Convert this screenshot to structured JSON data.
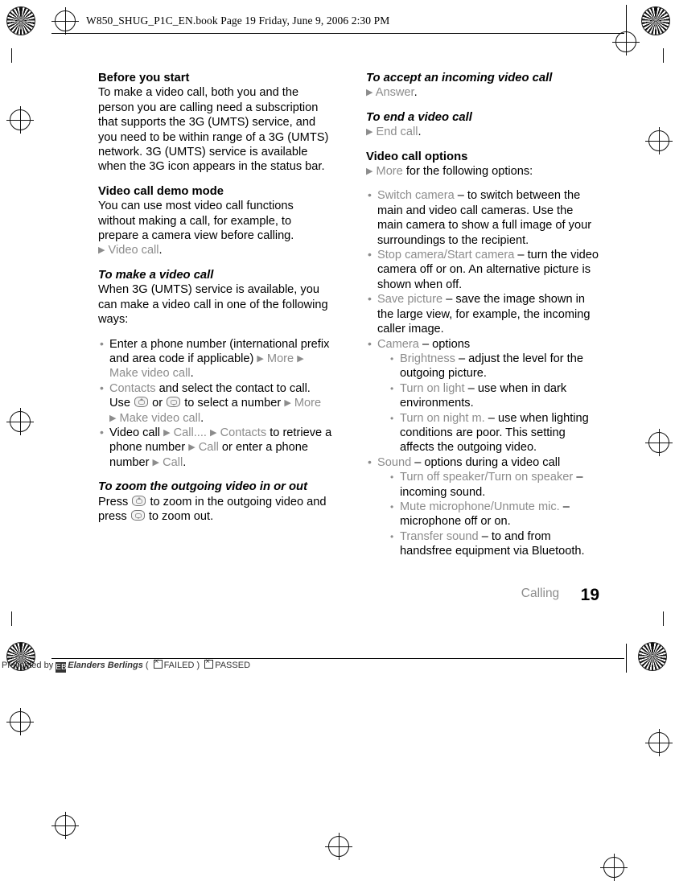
{
  "header": {
    "text": "W850_SHUG_P1C_EN.book  Page 19  Friday, June 9, 2006  2:30 PM"
  },
  "left_column": {
    "s1_title": "Before you start",
    "s1_body": "To make a video call, both you and the person you are calling need a subscription that supports the 3G (UMTS) service, and you need to be within range of a 3G (UMTS) network. 3G (UMTS) service is available when the 3G icon appears in the status bar.",
    "s2_title": "Video call demo mode",
    "s2_body": "You can use most video call functions without making a call, for example, to prepare a camera view before calling.",
    "s2_path": "Video call",
    "s3_title": "To make a video call",
    "s3_body": "When 3G (UMTS) service is available, you can make a video call in one of the following ways:",
    "b1_a": "Enter a phone number (international prefix and area code if applicable)",
    "b1_more": "More",
    "b1_make": "Make video call",
    "b2_contacts": "Contacts",
    "b2_a": "and select the contact to call. Use",
    "b2_or": "or",
    "b2_b": "to select a number",
    "b2_more": "More",
    "b2_make": "Make video call",
    "b3_a": "Video call",
    "b3_call": "Call....",
    "b3_contacts": "Contacts",
    "b3_b": "to retrieve a phone number",
    "b3_call2": "Call",
    "b3_c": "or enter a phone number",
    "b3_call3": "Call",
    "s4_title": "To zoom the outgoing video in or out",
    "s4_a": "Press",
    "s4_b": "to zoom in the outgoing video and press",
    "s4_c": "to zoom out."
  },
  "right_column": {
    "s1_title": "To accept an incoming video call",
    "s1_kw": "Answer",
    "s2_title": "To end a video call",
    "s2_kw": "End call",
    "s3_title": "Video call options",
    "s3_kw": "More",
    "s3_rest": "for the following options:",
    "items": [
      {
        "kw": "Switch camera",
        "text": "– to switch between the main and video call cameras. Use the main camera to show a full image of your surroundings to the recipient."
      },
      {
        "kw": "Stop camera",
        "kw2": "Start camera",
        "text": "– turn the video camera off or on. An alternative picture is shown when off."
      },
      {
        "kw": "Save picture",
        "text": "– save the image shown in the large view, for example, the incoming caller image."
      },
      {
        "kw": "Camera",
        "text": "– options",
        "sub": [
          {
            "kw": "Brightness",
            "text": "– adjust the level for the outgoing picture."
          },
          {
            "kw": "Turn on light",
            "text": "– use when in dark environments."
          },
          {
            "kw": "Turn on night m.",
            "text": "– use when lighting conditions are poor. This setting affects the outgoing video."
          }
        ]
      },
      {
        "kw": "Sound",
        "text": "– options during a video call",
        "sub": [
          {
            "kw": "Turn off speaker",
            "kw2": "Turn on speaker",
            "text": "– incoming sound."
          },
          {
            "kw": "Mute microphone",
            "kw2": "Unmute mic.",
            "text": "– microphone off or on."
          },
          {
            "kw": "Transfer sound",
            "text": "– to and from handsfree equipment via Bluetooth."
          }
        ]
      }
    ]
  },
  "footer": {
    "chapter": "Calling",
    "page_number": "19"
  },
  "bottom_bar": {
    "prelight": "Prelighted by",
    "company": "Elanders Berlings",
    "failed": "FAILED",
    "passed": "PASSED",
    "paren_left": "(",
    "paren_right": ")"
  }
}
